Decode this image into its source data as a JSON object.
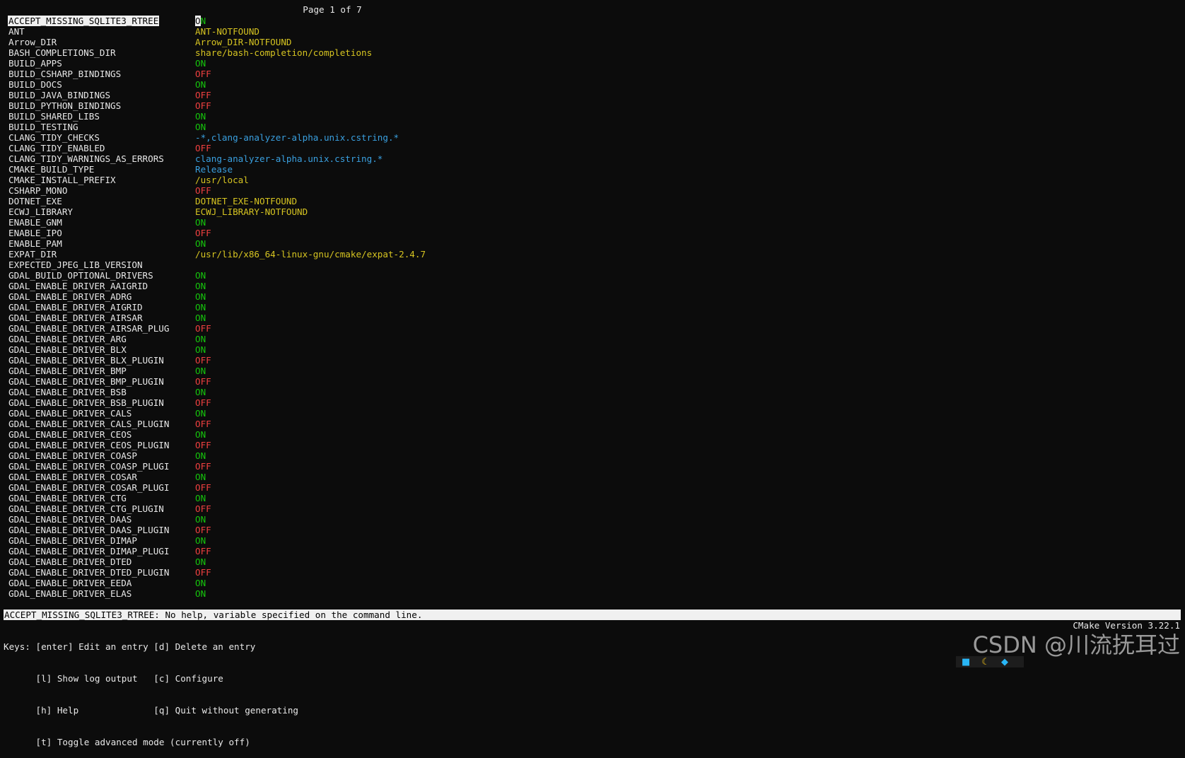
{
  "header": {
    "page_indicator": "Page 1 of 7"
  },
  "selected_value_first_char": "O",
  "selected_value_rest": "N",
  "entries": [
    {
      "key": "ACCEPT_MISSING_SQLITE3_RTREE",
      "value": "ON",
      "type": "on"
    },
    {
      "key": "ANT",
      "value": "ANT-NOTFOUND",
      "type": "path"
    },
    {
      "key": "Arrow_DIR",
      "value": "Arrow_DIR-NOTFOUND",
      "type": "path"
    },
    {
      "key": "BASH_COMPLETIONS_DIR",
      "value": "share/bash-completion/completions",
      "type": "path"
    },
    {
      "key": "BUILD_APPS",
      "value": "ON",
      "type": "on"
    },
    {
      "key": "BUILD_CSHARP_BINDINGS",
      "value": "OFF",
      "type": "off"
    },
    {
      "key": "BUILD_DOCS",
      "value": "ON",
      "type": "on"
    },
    {
      "key": "BUILD_JAVA_BINDINGS",
      "value": "OFF",
      "type": "off"
    },
    {
      "key": "BUILD_PYTHON_BINDINGS",
      "value": "OFF",
      "type": "off"
    },
    {
      "key": "BUILD_SHARED_LIBS",
      "value": "ON",
      "type": "on"
    },
    {
      "key": "BUILD_TESTING",
      "value": "ON",
      "type": "on"
    },
    {
      "key": "CLANG_TIDY_CHECKS",
      "value": "-*,clang-analyzer-alpha.unix.cstring.*",
      "type": "str"
    },
    {
      "key": "CLANG_TIDY_ENABLED",
      "value": "OFF",
      "type": "off"
    },
    {
      "key": "CLANG_TIDY_WARNINGS_AS_ERRORS",
      "value": "clang-analyzer-alpha.unix.cstring.*",
      "type": "str"
    },
    {
      "key": "CMAKE_BUILD_TYPE",
      "value": "Release",
      "type": "str"
    },
    {
      "key": "CMAKE_INSTALL_PREFIX",
      "value": "/usr/local",
      "type": "path"
    },
    {
      "key": "CSHARP_MONO",
      "value": "OFF",
      "type": "off"
    },
    {
      "key": "DOTNET_EXE",
      "value": "DOTNET_EXE-NOTFOUND",
      "type": "path"
    },
    {
      "key": "ECWJ_LIBRARY",
      "value": "ECWJ_LIBRARY-NOTFOUND",
      "type": "path"
    },
    {
      "key": "ENABLE_GNM",
      "value": "ON",
      "type": "on"
    },
    {
      "key": "ENABLE_IPO",
      "value": "OFF",
      "type": "off"
    },
    {
      "key": "ENABLE_PAM",
      "value": "ON",
      "type": "on"
    },
    {
      "key": "EXPAT_DIR",
      "value": "/usr/lib/x86_64-linux-gnu/cmake/expat-2.4.7",
      "type": "path"
    },
    {
      "key": "EXPECTED_JPEG_LIB_VERSION",
      "value": "",
      "type": "path"
    },
    {
      "key": "GDAL_BUILD_OPTIONAL_DRIVERS",
      "value": "ON",
      "type": "on"
    },
    {
      "key": "GDAL_ENABLE_DRIVER_AAIGRID",
      "value": "ON",
      "type": "on"
    },
    {
      "key": "GDAL_ENABLE_DRIVER_ADRG",
      "value": "ON",
      "type": "on"
    },
    {
      "key": "GDAL_ENABLE_DRIVER_AIGRID",
      "value": "ON",
      "type": "on"
    },
    {
      "key": "GDAL_ENABLE_DRIVER_AIRSAR",
      "value": "ON",
      "type": "on"
    },
    {
      "key": "GDAL_ENABLE_DRIVER_AIRSAR_PLUG",
      "value": "OFF",
      "type": "off"
    },
    {
      "key": "GDAL_ENABLE_DRIVER_ARG",
      "value": "ON",
      "type": "on"
    },
    {
      "key": "GDAL_ENABLE_DRIVER_BLX",
      "value": "ON",
      "type": "on"
    },
    {
      "key": "GDAL_ENABLE_DRIVER_BLX_PLUGIN",
      "value": "OFF",
      "type": "off"
    },
    {
      "key": "GDAL_ENABLE_DRIVER_BMP",
      "value": "ON",
      "type": "on"
    },
    {
      "key": "GDAL_ENABLE_DRIVER_BMP_PLUGIN",
      "value": "OFF",
      "type": "off"
    },
    {
      "key": "GDAL_ENABLE_DRIVER_BSB",
      "value": "ON",
      "type": "on"
    },
    {
      "key": "GDAL_ENABLE_DRIVER_BSB_PLUGIN",
      "value": "OFF",
      "type": "off"
    },
    {
      "key": "GDAL_ENABLE_DRIVER_CALS",
      "value": "ON",
      "type": "on"
    },
    {
      "key": "GDAL_ENABLE_DRIVER_CALS_PLUGIN",
      "value": "OFF",
      "type": "off"
    },
    {
      "key": "GDAL_ENABLE_DRIVER_CEOS",
      "value": "ON",
      "type": "on"
    },
    {
      "key": "GDAL_ENABLE_DRIVER_CEOS_PLUGIN",
      "value": "OFF",
      "type": "off"
    },
    {
      "key": "GDAL_ENABLE_DRIVER_COASP",
      "value": "ON",
      "type": "on"
    },
    {
      "key": "GDAL_ENABLE_DRIVER_COASP_PLUGI",
      "value": "OFF",
      "type": "off"
    },
    {
      "key": "GDAL_ENABLE_DRIVER_COSAR",
      "value": "ON",
      "type": "on"
    },
    {
      "key": "GDAL_ENABLE_DRIVER_COSAR_PLUGI",
      "value": "OFF",
      "type": "off"
    },
    {
      "key": "GDAL_ENABLE_DRIVER_CTG",
      "value": "ON",
      "type": "on"
    },
    {
      "key": "GDAL_ENABLE_DRIVER_CTG_PLUGIN",
      "value": "OFF",
      "type": "off"
    },
    {
      "key": "GDAL_ENABLE_DRIVER_DAAS",
      "value": "ON",
      "type": "on"
    },
    {
      "key": "GDAL_ENABLE_DRIVER_DAAS_PLUGIN",
      "value": "OFF",
      "type": "off"
    },
    {
      "key": "GDAL_ENABLE_DRIVER_DIMAP",
      "value": "ON",
      "type": "on"
    },
    {
      "key": "GDAL_ENABLE_DRIVER_DIMAP_PLUGI",
      "value": "OFF",
      "type": "off"
    },
    {
      "key": "GDAL_ENABLE_DRIVER_DTED",
      "value": "ON",
      "type": "on"
    },
    {
      "key": "GDAL_ENABLE_DRIVER_DTED_PLUGIN",
      "value": "OFF",
      "type": "off"
    },
    {
      "key": "GDAL_ENABLE_DRIVER_EEDA",
      "value": "ON",
      "type": "on"
    },
    {
      "key": "GDAL_ENABLE_DRIVER_ELAS",
      "value": "ON",
      "type": "on"
    }
  ],
  "status_bar": "ACCEPT_MISSING_SQLITE3_RTREE: No help, variable specified on the command line.",
  "keys_help": [
    "Keys: [enter] Edit an entry [d] Delete an entry",
    "      [l] Show log output   [c] Configure",
    "      [h] Help              [q] Quit without generating",
    "      [t] Toggle advanced mode (currently off)"
  ],
  "cmake_version": "CMake Version 3.22.1",
  "watermark": "CSDN @川流抚耳过",
  "colors": {
    "background": "#0c0c0c",
    "on": "#16c60c",
    "off": "#f04040",
    "path": "#d6c421",
    "string": "#3aa0e0",
    "selection": "#f0f0f0"
  }
}
